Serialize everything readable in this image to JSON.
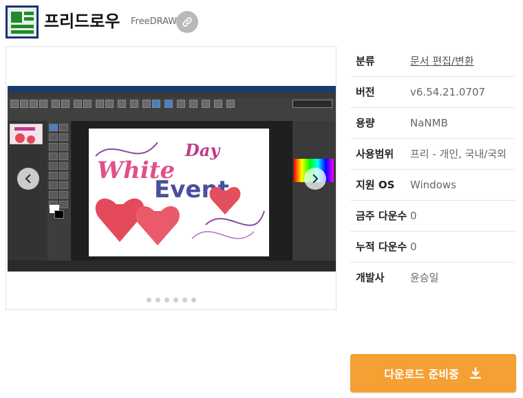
{
  "app": {
    "name": "프리드로우",
    "name_en": "FreeDRAW",
    "icon": "freedraw-app-icon",
    "link_icon": "link-icon"
  },
  "gallery": {
    "prev_icon": "chevron-left-icon",
    "next_icon": "chevron-right-icon",
    "slide_count": 6,
    "screenshot_text": {
      "line1": "White",
      "line2": "Day",
      "line3": "Event"
    }
  },
  "info": {
    "rows": [
      {
        "label": "분류",
        "value": "문서 편집/변환"
      },
      {
        "label": "버전",
        "value": "v6.54.21.0707"
      },
      {
        "label": "용량",
        "value": "NaNMB"
      },
      {
        "label": "사용범위",
        "value": "프리 - 개인, 국내/국외"
      },
      {
        "label": "지원 OS",
        "value": "Windows"
      },
      {
        "label": "금주 다운수",
        "value": "0"
      },
      {
        "label": "누적 다운수",
        "value": "0"
      },
      {
        "label": "개발사",
        "value": "윤승일"
      }
    ]
  },
  "download": {
    "label": "다운로드 준비중",
    "icon": "download-icon"
  },
  "colors": {
    "accent": "#f5a033",
    "link_btn": "#b9b9b9",
    "icon_border": "#1b2f7a",
    "icon_green": "#1f8a2e"
  }
}
